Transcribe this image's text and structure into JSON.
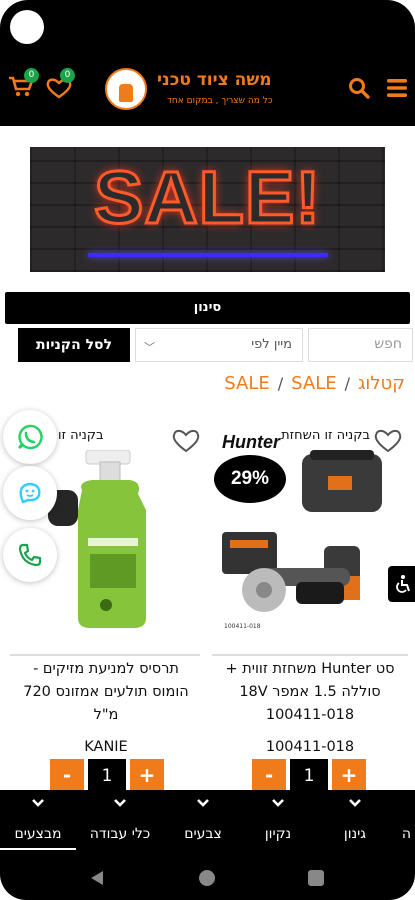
{
  "header": {
    "store_title": "משה ציוד טכני",
    "store_tagline": "כל מה שצריך , במקום אחד",
    "cart_count": "0",
    "wishlist_count": "0"
  },
  "banner": {
    "text": "SALE!"
  },
  "filter": {
    "label": "סינון"
  },
  "controls": {
    "search_placeholder": "חפש",
    "sort_label": "מיין לפי",
    "cart_button": "לסל הקניות"
  },
  "breadcrumb": [
    "קטלוג",
    "SALE",
    "SALE"
  ],
  "products": [
    {
      "buy_label": "בקניה זו השחזת",
      "brand": "Hunter",
      "discount_badge": "29%",
      "title_lines": [
        "סט Hunter משחזת זווית +",
        "סוללה 1.5 אמפר 18V",
        "100411-018"
      ],
      "sku": "100411-018",
      "qty": "1"
    },
    {
      "buy_label": "בקניה זו",
      "title_lines": [
        "תרסיס למניעת מזיקים -",
        "הומוס תולעים אמזונס 720",
        "מ\"ל"
      ],
      "sku": "KANIE",
      "qty": "1"
    }
  ],
  "qty_controls": {
    "minus": "-",
    "plus": "+"
  },
  "categories": [
    "ה",
    "גינון",
    "נקיון",
    "צבעים",
    "כלי עבודה",
    "מבצעים"
  ],
  "colors": {
    "accent": "#f07b1b",
    "dark": "#000000"
  }
}
